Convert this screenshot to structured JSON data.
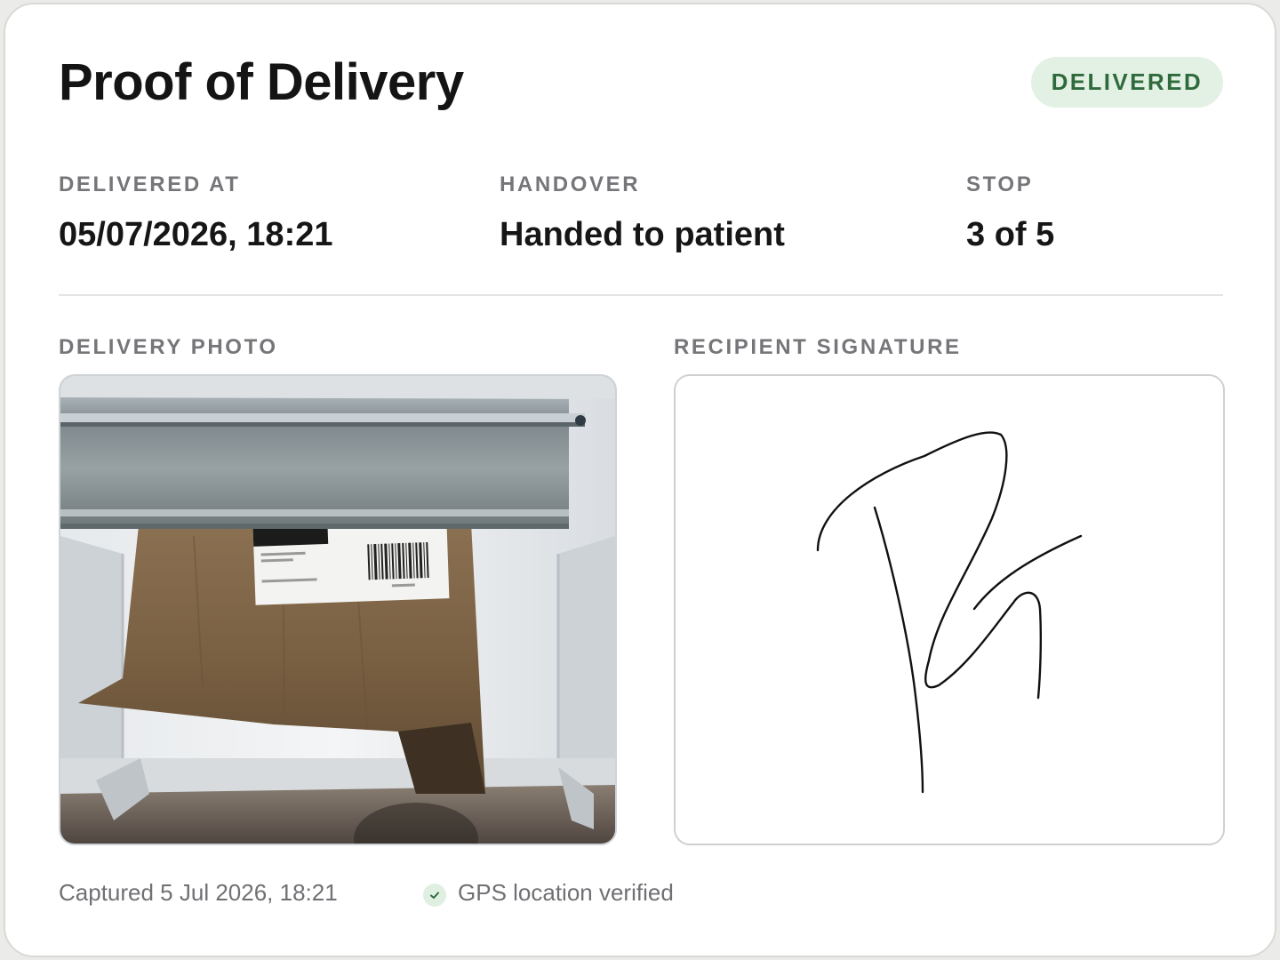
{
  "header": {
    "title": "Proof of Delivery",
    "status_badge": "DELIVERED"
  },
  "details": {
    "delivered_at": {
      "label": "DELIVERED AT",
      "value": "05/07/2026, 18:21"
    },
    "handover": {
      "label": "HANDOVER",
      "value": "Handed to patient"
    },
    "stop": {
      "label": "STOP",
      "value": "3 of 5"
    }
  },
  "photo_section": {
    "label": "DELIVERY PHOTO"
  },
  "signature_section": {
    "label": "RECIPIENT SIGNATURE"
  },
  "footer": {
    "captured": "Captured 5 Jul 2026, 18:21",
    "gps_status": "GPS location verified"
  },
  "colors": {
    "badge_bg": "#e2f1e4",
    "badge_text": "#2f6a3c",
    "label_gray": "#76767a",
    "check_green": "#2f6a3c"
  },
  "icons": {
    "gps": "check-circle-icon"
  }
}
